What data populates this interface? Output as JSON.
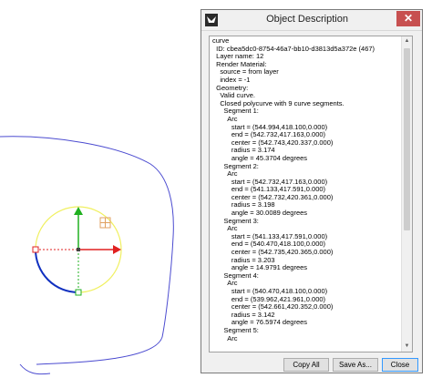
{
  "window": {
    "title": "Object Description"
  },
  "description_lines": [
    "curve",
    "  ID: cbea5dc0-8754-46a7-bb10-d3813d5a372e (467)",
    "  Layer name: 12",
    "  Render Material:",
    "    source = from layer",
    "    index = -1",
    "  Geometry:",
    "    Valid curve.",
    "    Closed polycurve with 9 curve segments.",
    "      Segment 1:",
    "        Arc",
    "          start = (544.994,418.100,0.000)",
    "          end = (542.732,417.163,0.000)",
    "          center = (542.743,420.337,0.000)",
    "          radius = 3.174",
    "          angle = 45.3704 degrees",
    "      Segment 2:",
    "        Arc",
    "          start = (542.732,417.163,0.000)",
    "          end = (541.133,417.591,0.000)",
    "          center = (542.732,420.361,0.000)",
    "          radius = 3.198",
    "          angle = 30.0089 degrees",
    "      Segment 3:",
    "        Arc",
    "          start = (541.133,417.591,0.000)",
    "          end = (540.470,418.100,0.000)",
    "          center = (542.735,420.365,0.000)",
    "          radius = 3.203",
    "          angle = 14.9791 degrees",
    "      Segment 4:",
    "        Arc",
    "          start = (540.470,418.100,0.000)",
    "          end = (539.962,421.961,0.000)",
    "          center = (542.661,420.352,0.000)",
    "          radius = 3.142",
    "          angle = 76.5974 degrees",
    "      Segment 5:",
    "        Arc"
  ],
  "buttons": {
    "copy_all": "Copy All",
    "save_as": "Save As...",
    "close": "Close"
  },
  "colors": {
    "curve": "#4b4bd0",
    "gumball_x": "#e02020",
    "gumball_y": "#20b020",
    "gumball_ring": "#f0f060",
    "selected_arc": "#1030c0"
  }
}
